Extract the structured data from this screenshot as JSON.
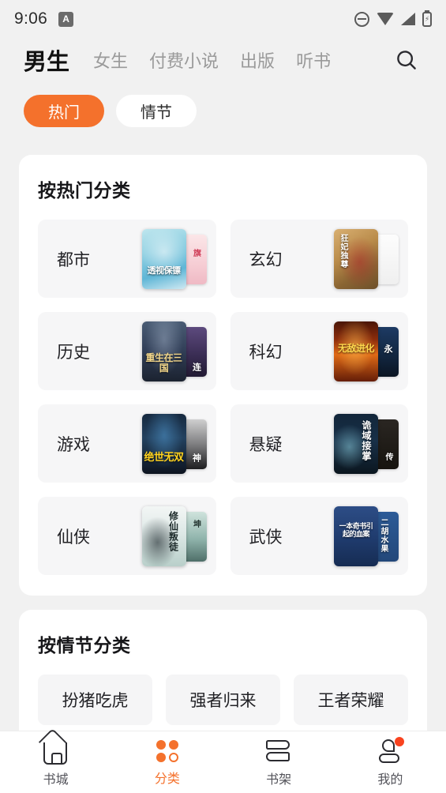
{
  "status_bar": {
    "time": "9:06",
    "app_badge_letter": "A",
    "icons": [
      "do-not-disturb-icon",
      "wifi-icon",
      "cellular-signal-icon",
      "battery-charging-icon"
    ]
  },
  "header": {
    "tabs": [
      {
        "label": "男生",
        "active": true
      },
      {
        "label": "女生",
        "active": false
      },
      {
        "label": "付费小说",
        "active": false
      },
      {
        "label": "出版",
        "active": false
      },
      {
        "label": "听书",
        "active": false
      }
    ],
    "search_icon": "search-icon"
  },
  "filter_pills": [
    {
      "label": "热门",
      "active": true
    },
    {
      "label": "情节",
      "active": false
    }
  ],
  "colors": {
    "accent": "#F4712C",
    "page_bg": "#F1F1F1",
    "card_bg": "#FFFFFF",
    "cell_bg": "#F6F6F7",
    "badge": "#F9431F",
    "text_primary": "#222226",
    "text_muted": "#9A9A9A"
  },
  "sections": [
    {
      "title": "按热门分类",
      "items": [
        {
          "label": "都市",
          "cover_title": "透视保镖"
        },
        {
          "label": "玄幻",
          "cover_title": "狂妃独尊"
        },
        {
          "label": "历史",
          "cover_title": "重生在三国"
        },
        {
          "label": "科幻",
          "cover_title": "无敌进化"
        },
        {
          "label": "游戏",
          "cover_title": "绝世无双"
        },
        {
          "label": "悬疑",
          "cover_title": "诡域接掌"
        },
        {
          "label": "仙侠",
          "cover_title": "修仙叛徒"
        },
        {
          "label": "武侠",
          "cover_title": "一本奇书引起的血案"
        }
      ]
    },
    {
      "title": "按情节分类",
      "chips": [
        "扮猪吃虎",
        "强者归来",
        "王者荣耀"
      ]
    }
  ],
  "bottom_nav": [
    {
      "label": "书城",
      "icon": "home-icon",
      "active": false,
      "badge": false
    },
    {
      "label": "分类",
      "icon": "grid-category-icon",
      "active": true,
      "badge": false
    },
    {
      "label": "书架",
      "icon": "bookshelf-icon",
      "active": false,
      "badge": false
    },
    {
      "label": "我的",
      "icon": "person-icon",
      "active": false,
      "badge": true
    }
  ]
}
